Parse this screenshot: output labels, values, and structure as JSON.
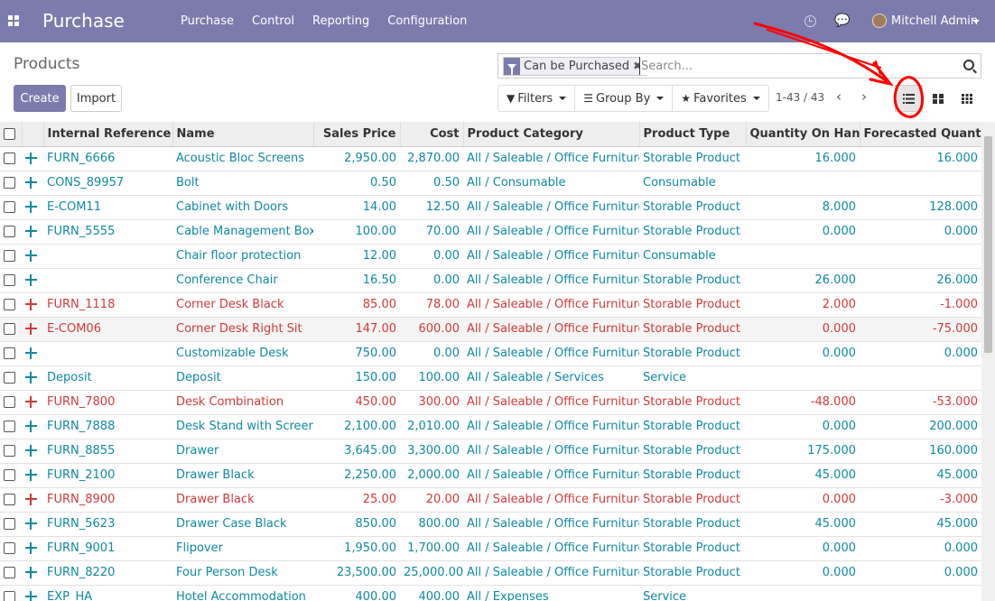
{
  "navbar": {
    "brand": "Purchase",
    "menu": [
      "Purchase",
      "Control",
      "Reporting",
      "Configuration"
    ],
    "user_name": "Mitchell Admin",
    "color": "#7c7bad"
  },
  "control_panel": {
    "title": "Products",
    "create_label": "Create",
    "import_label": "Import",
    "search": {
      "facet": "Can be Purchased",
      "placeholder": "Search..."
    },
    "filters_label": "Filters",
    "groupby_label": "Group By",
    "favorites_label": "Favorites",
    "pager": "1-43 / 43"
  },
  "table": {
    "columns": [
      "Internal Reference",
      "Name",
      "Sales Price",
      "Cost",
      "Product Category",
      "Product Type",
      "Quantity On Hand",
      "Forecasted Quantity"
    ],
    "rows": [
      {
        "ref": "FURN_6666",
        "name": "Acoustic Bloc Screens",
        "price": "2,950.00",
        "cost": "2,870.00",
        "category": "All / Saleable / Office Furniture",
        "type": "Storable Product",
        "onhand": "16.000",
        "forecast": "16.000",
        "red": false
      },
      {
        "ref": "CONS_89957",
        "name": "Bolt",
        "price": "0.50",
        "cost": "0.50",
        "category": "All / Consumable",
        "type": "Consumable",
        "onhand": "",
        "forecast": "",
        "red": false
      },
      {
        "ref": "E-COM11",
        "name": "Cabinet with Doors",
        "price": "14.00",
        "cost": "12.50",
        "category": "All / Saleable / Office Furniture",
        "type": "Storable Product",
        "onhand": "8.000",
        "forecast": "128.000",
        "red": false
      },
      {
        "ref": "FURN_5555",
        "name": "Cable Management Box",
        "price": "100.00",
        "cost": "70.00",
        "category": "All / Saleable / Office Furniture",
        "type": "Storable Product",
        "onhand": "0.000",
        "forecast": "0.000",
        "red": false
      },
      {
        "ref": "",
        "name": "Chair floor protection",
        "price": "12.00",
        "cost": "0.00",
        "category": "All / Saleable / Office Furniture",
        "type": "Consumable",
        "onhand": "",
        "forecast": "",
        "red": false
      },
      {
        "ref": "",
        "name": "Conference Chair",
        "price": "16.50",
        "cost": "0.00",
        "category": "All / Saleable / Office Furniture",
        "type": "Storable Product",
        "onhand": "26.000",
        "forecast": "26.000",
        "red": false
      },
      {
        "ref": "FURN_1118",
        "name": "Corner Desk Black",
        "price": "85.00",
        "cost": "78.00",
        "category": "All / Saleable / Office Furniture",
        "type": "Storable Product",
        "onhand": "2.000",
        "forecast": "-1.000",
        "red": true
      },
      {
        "ref": "E-COM06",
        "name": "Corner Desk Right Sit",
        "price": "147.00",
        "cost": "600.00",
        "category": "All / Saleable / Office Furniture",
        "type": "Storable Product",
        "onhand": "0.000",
        "forecast": "-75.000",
        "red": true
      },
      {
        "ref": "",
        "name": "Customizable Desk",
        "price": "750.00",
        "cost": "0.00",
        "category": "All / Saleable / Office Furniture",
        "type": "Storable Product",
        "onhand": "0.000",
        "forecast": "0.000",
        "red": false
      },
      {
        "ref": "Deposit",
        "name": "Deposit",
        "price": "150.00",
        "cost": "100.00",
        "category": "All / Saleable / Services",
        "type": "Service",
        "onhand": "",
        "forecast": "",
        "red": false
      },
      {
        "ref": "FURN_7800",
        "name": "Desk Combination",
        "price": "450.00",
        "cost": "300.00",
        "category": "All / Saleable / Office Furniture",
        "type": "Storable Product",
        "onhand": "-48.000",
        "forecast": "-53.000",
        "red": true
      },
      {
        "ref": "FURN_7888",
        "name": "Desk Stand with Screen",
        "price": "2,100.00",
        "cost": "2,010.00",
        "category": "All / Saleable / Office Furniture",
        "type": "Storable Product",
        "onhand": "0.000",
        "forecast": "200.000",
        "red": false
      },
      {
        "ref": "FURN_8855",
        "name": "Drawer",
        "price": "3,645.00",
        "cost": "3,300.00",
        "category": "All / Saleable / Office Furniture",
        "type": "Storable Product",
        "onhand": "175.000",
        "forecast": "160.000",
        "red": false
      },
      {
        "ref": "FURN_2100",
        "name": "Drawer Black",
        "price": "2,250.00",
        "cost": "2,000.00",
        "category": "All / Saleable / Office Furniture",
        "type": "Storable Product",
        "onhand": "45.000",
        "forecast": "45.000",
        "red": false
      },
      {
        "ref": "FURN_8900",
        "name": "Drawer Black",
        "price": "25.00",
        "cost": "20.00",
        "category": "All / Saleable / Office Furniture",
        "type": "Storable Product",
        "onhand": "0.000",
        "forecast": "-3.000",
        "red": true
      },
      {
        "ref": "FURN_5623",
        "name": "Drawer Case Black",
        "price": "850.00",
        "cost": "800.00",
        "category": "All / Saleable / Office Furniture",
        "type": "Storable Product",
        "onhand": "45.000",
        "forecast": "45.000",
        "red": false
      },
      {
        "ref": "FURN_9001",
        "name": "Flipover",
        "price": "1,950.00",
        "cost": "1,700.00",
        "category": "All / Saleable / Office Furniture",
        "type": "Storable Product",
        "onhand": "0.000",
        "forecast": "0.000",
        "red": false
      },
      {
        "ref": "FURN_8220",
        "name": "Four Person Desk",
        "price": "23,500.00",
        "cost": "25,000.00",
        "category": "All / Saleable / Office Furniture",
        "type": "Storable Product",
        "onhand": "0.000",
        "forecast": "0.000",
        "red": false
      },
      {
        "ref": "EXP_HA",
        "name": "Hotel Accommodation",
        "price": "400.00",
        "cost": "400.00",
        "category": "All / Expenses",
        "type": "Service",
        "onhand": "",
        "forecast": "",
        "red": false
      }
    ],
    "text_color": "#0e8aa0",
    "warning_color": "#d23a3a"
  }
}
